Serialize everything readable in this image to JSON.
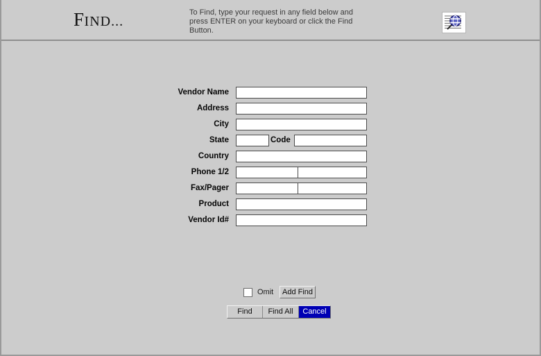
{
  "header": {
    "title_cap": "F",
    "title_rest": "IND...",
    "instructions": "To Find, type your request in any field below and press ENTER on your keyboard or click the Find Button.",
    "icon_name": "find-magnifier-icon"
  },
  "form": {
    "fields": [
      {
        "label": "Vendor Name",
        "value": "",
        "placeholder": "",
        "type": "single"
      },
      {
        "label": "Address",
        "value": "",
        "placeholder": "",
        "type": "single"
      },
      {
        "label": "City",
        "value": "",
        "placeholder": "",
        "type": "single"
      },
      {
        "label": "State",
        "value": "",
        "placeholder": "",
        "type": "pair",
        "mid_label": "Code",
        "value2": ""
      },
      {
        "label": "Country",
        "value": "",
        "placeholder": "",
        "type": "single"
      },
      {
        "label": "Phone 1/2",
        "value": "",
        "placeholder": "",
        "type": "split",
        "value2": ""
      },
      {
        "label": "Fax/Pager",
        "value": "",
        "placeholder": "",
        "type": "split",
        "value2": ""
      },
      {
        "label": "Product",
        "value": "",
        "placeholder": "",
        "type": "single"
      },
      {
        "label": "Vendor Id#",
        "value": "",
        "placeholder": "",
        "type": "single"
      }
    ]
  },
  "controls": {
    "omit_label": "Omit",
    "omit_checked": false,
    "add_find_label": "Add Find",
    "find_label": "Find",
    "find_all_label": "Find All",
    "cancel_label": "Cancel"
  },
  "colors": {
    "background": "#cccccc",
    "field_background": "#ffffff",
    "field_border": "#4b4b4b",
    "highlight": "#0000b4",
    "highlight_text": "#ffffff",
    "divider": "#8e8e8e",
    "window_border": "#999999",
    "icon_blue": "#5b62c4"
  }
}
